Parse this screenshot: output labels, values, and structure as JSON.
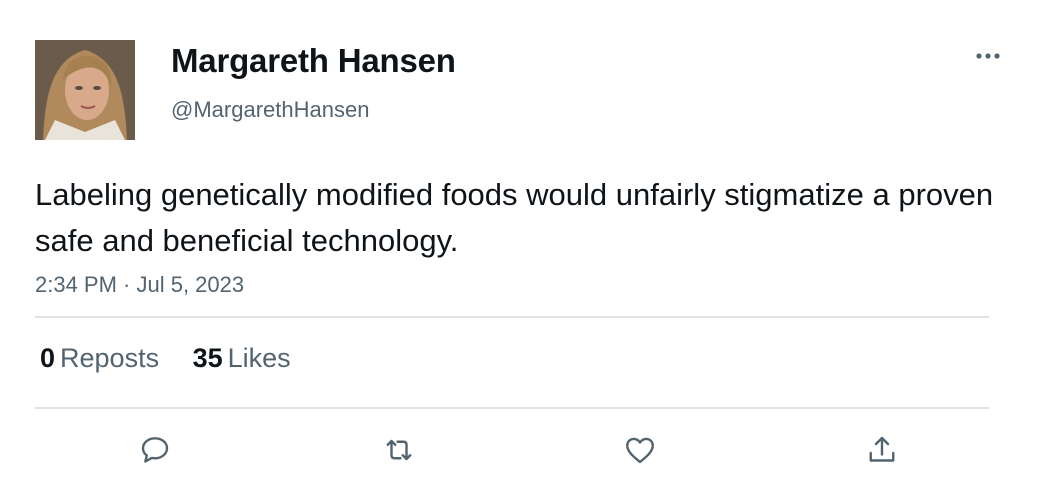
{
  "user": {
    "display_name": "Margareth Hansen",
    "handle": "@MargarethHansen",
    "avatar": "profile-photo"
  },
  "tweet": {
    "text": "Labeling genetically modified foods would unfairly stigmatize a proven safe and beneficial technology.",
    "timestamp": "2:34 PM · Jul 5, 2023"
  },
  "stats": {
    "reposts_count": "0",
    "reposts_label": "Reposts",
    "likes_count": "35",
    "likes_label": "Likes"
  },
  "actions": {
    "icons": [
      "reply-icon",
      "repost-icon",
      "like-icon",
      "share-icon"
    ]
  },
  "colors": {
    "text_primary": "#0f1419",
    "text_secondary": "#536471",
    "divider": "#dfe3e6"
  }
}
